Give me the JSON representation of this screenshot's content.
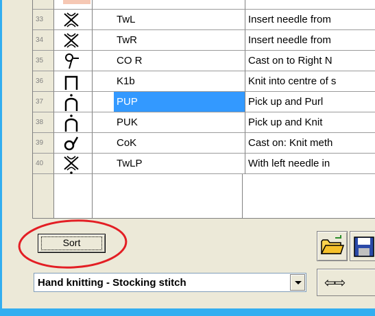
{
  "rows": [
    {
      "num": "33",
      "symbol": "twist-x-icon",
      "abbr": "TwL",
      "desc": "Insert needle from"
    },
    {
      "num": "34",
      "symbol": "twist-x-icon",
      "abbr": "TwR",
      "desc": "Insert needle from"
    },
    {
      "num": "35",
      "symbol": "cast-on-right-icon",
      "abbr": "CO R",
      "desc": "Cast on to Right N"
    },
    {
      "num": "36",
      "symbol": "square-bracket-icon",
      "abbr": "K1b",
      "desc": "Knit into centre of s"
    },
    {
      "num": "37",
      "symbol": "arch-dot-icon",
      "abbr": "PUP",
      "desc": "Pick up and Purl"
    },
    {
      "num": "38",
      "symbol": "arch-dot-icon",
      "abbr": "PUK",
      "desc": "Pick up and Knit"
    },
    {
      "num": "39",
      "symbol": "cast-on-knit-icon",
      "abbr": "CoK",
      "desc": "Cast on: Knit meth"
    },
    {
      "num": "40",
      "symbol": "twist-x-dot-icon",
      "abbr": "TwLP",
      "desc": "With left needle in"
    }
  ],
  "selected_row": 4,
  "sort_label": "Sort",
  "style_select": {
    "value": "Hand knitting - Stocking stitch"
  },
  "toolbar": {
    "swap_glyph": "⇦⇨"
  },
  "colors": {
    "selection": "#3399ff",
    "highlight_ellipse": "#e31e24",
    "background": "#33aef0"
  }
}
